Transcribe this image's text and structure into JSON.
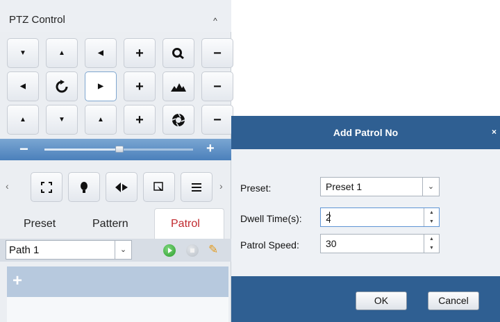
{
  "ptz": {
    "title": "PTZ Control",
    "collapse_glyph": "^",
    "pad_buttons": [
      [
        "tri-down-left",
        "tri-up",
        "tri-down-right",
        "plus",
        "zoom-icon",
        "minus"
      ],
      [
        "tri-left",
        "auto-scan-icon",
        "tri-right",
        "plus",
        "focus-icon",
        "minus"
      ],
      [
        "tri-up-left",
        "tri-down",
        "tri-up-right",
        "plus",
        "iris-icon",
        "minus"
      ]
    ],
    "speed": {
      "minus": "−",
      "plus": "+",
      "level": 0.5
    },
    "tools": [
      "fullscreen-icon",
      "light-icon",
      "wiper-icon",
      "one-touch-focus-icon",
      "menu-icon"
    ],
    "tabs": {
      "preset": "Preset",
      "pattern": "Pattern",
      "patrol": "Patrol"
    },
    "path_select": {
      "value": "Path 1"
    },
    "add_glyph": "+"
  },
  "dialog": {
    "title": "Add Patrol No",
    "close": "×",
    "preset_label": "Preset:",
    "preset_value": "Preset 1",
    "dwell_label": "Dwell Time(s):",
    "dwell_value": "2",
    "speed_label": "Patrol Speed:",
    "speed_value": "30",
    "ok": "OK",
    "cancel": "Cancel"
  }
}
